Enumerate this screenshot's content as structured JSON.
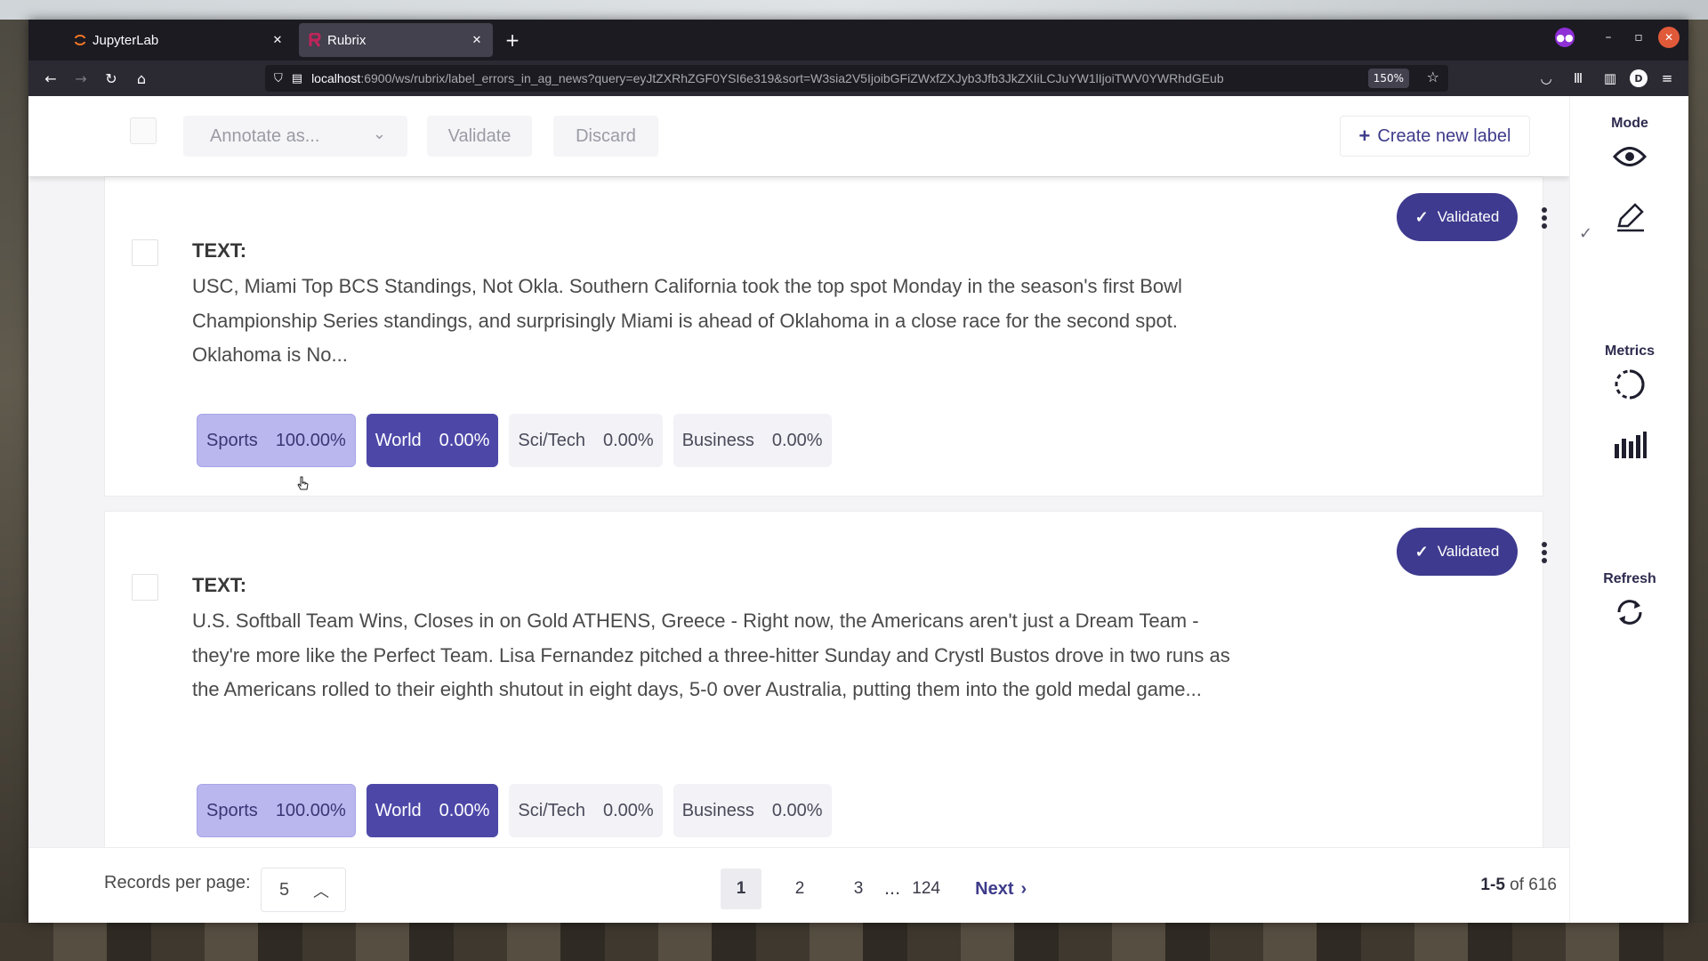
{
  "browser": {
    "tabs": [
      {
        "title": "JupyterLab",
        "icon": "jupyter-icon",
        "active": false
      },
      {
        "title": "Rubrix",
        "icon": "rubrix-icon",
        "active": true
      }
    ],
    "url_host": "localhost",
    "url_rest": ":6900/ws/rubrix/label_errors_in_ag_news?query=eyJtZXRhZGF0YSI6e319&sort=W3sia2V5IjoibGFiZWxfZXJyb3Jfb3JkZXIiLCJuYW1lIjoiTWV0YWRhdGEub",
    "zoom": "150%"
  },
  "toolbar": {
    "annotate_placeholder": "Annotate as...",
    "validate_label": "Validate",
    "discard_label": "Discard",
    "create_label": "Create new label"
  },
  "sidebar": {
    "mode_label": "Mode",
    "metrics_label": "Metrics",
    "refresh_label": "Refresh"
  },
  "records": [
    {
      "field": "TEXT:",
      "text": "USC, Miami Top BCS Standings, Not Okla. Southern California took the top spot Monday in the season's first Bowl Championship Series standings, and surprisingly Miami is ahead of Oklahoma in a close race for the second spot. Oklahoma is No...",
      "status": "Validated",
      "labels": [
        {
          "name": "Sports",
          "score": "100.00%"
        },
        {
          "name": "World",
          "score": "0.00%"
        },
        {
          "name": "Sci/Tech",
          "score": "0.00%"
        },
        {
          "name": "Business",
          "score": "0.00%"
        }
      ]
    },
    {
      "field": "TEXT:",
      "text": "U.S. Softball Team Wins, Closes in on Gold ATHENS, Greece - Right now, the Americans aren't just a Dream Team - they're more like the Perfect Team. Lisa Fernandez pitched a three-hitter Sunday and Crystl Bustos drove in two runs as the Americans rolled to their eighth shutout in eight days, 5-0 over Australia, putting them into the gold medal game...",
      "status": "Validated",
      "labels": [
        {
          "name": "Sports",
          "score": "100.00%"
        },
        {
          "name": "World",
          "score": "0.00%"
        },
        {
          "name": "Sci/Tech",
          "score": "0.00%"
        },
        {
          "name": "Business",
          "score": "0.00%"
        }
      ]
    }
  ],
  "pagination": {
    "rpp_label": "Records per page:",
    "rpp_value": "5",
    "pages": [
      "1",
      "2",
      "3",
      "124"
    ],
    "ellipsis": "...",
    "current": "1",
    "next_label": "Next",
    "range": "1-5",
    "of_label": "of 616"
  },
  "colors": {
    "accent": "#3e3a8f",
    "sports_chip": "#b9b7ee",
    "world_chip": "#4d48a8"
  }
}
